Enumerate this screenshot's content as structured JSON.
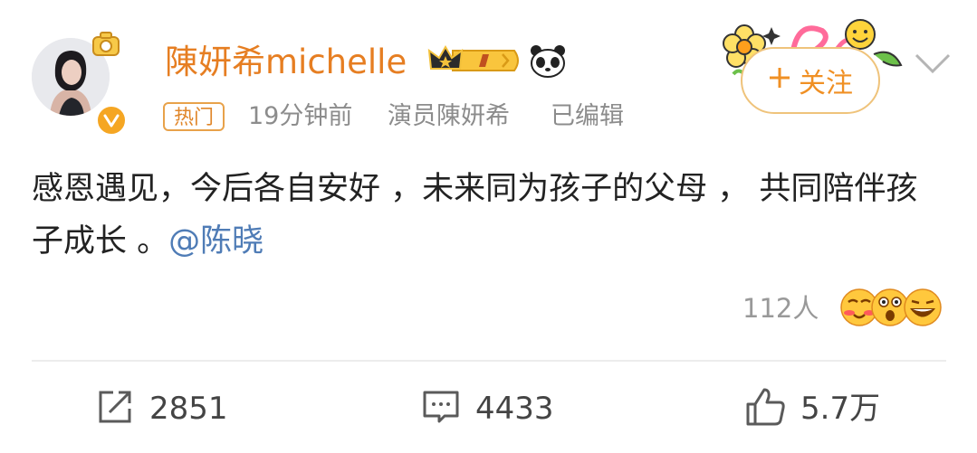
{
  "user": {
    "name": "陳妍希michelle",
    "hot_tag": "热门",
    "time": "19分钟前",
    "source": "演员陳妍希",
    "edited": "已编辑"
  },
  "follow_button": {
    "icon": "plus-icon",
    "label": "关注"
  },
  "post": {
    "text": "感恩遇见，今后各自安好 ，未来同为孩子的父母 ， 共同陪伴孩子成长 。",
    "mention": "@陈晓"
  },
  "reactions": {
    "count_label": "112人"
  },
  "actions": {
    "repost": {
      "icon": "share-icon",
      "count": "2851"
    },
    "comment": {
      "icon": "comment-icon",
      "count": "4433"
    },
    "like": {
      "icon": "thumbs-up-icon",
      "count": "5.7万"
    }
  },
  "colors": {
    "name": "#e67e22",
    "follow": "#f09024",
    "mention": "#4f7cb6",
    "verified": "#f5a623"
  }
}
